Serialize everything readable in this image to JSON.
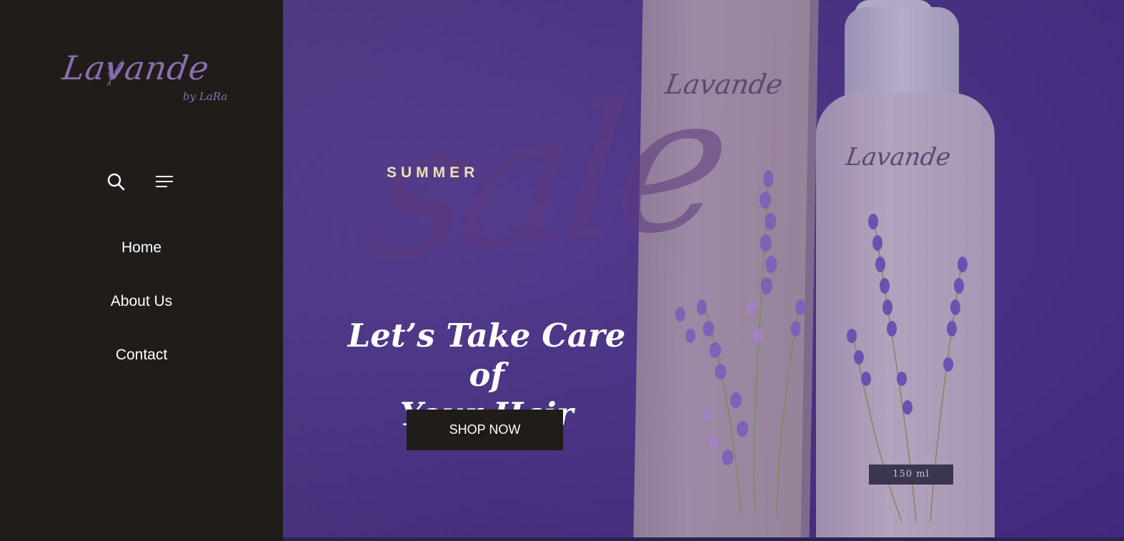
{
  "brand": {
    "logo_text": "Lavande",
    "logo_byline": "by LaRa"
  },
  "sidebar": {
    "icons": [
      "search-icon",
      "hamburger-menu-icon"
    ],
    "nav": [
      {
        "label": "Home"
      },
      {
        "label": "About Us"
      },
      {
        "label": "Contact"
      }
    ]
  },
  "hero": {
    "eyebrow": "SUMMER",
    "script_word": "sale",
    "headline_line1": "Let’s Take Care of",
    "headline_line2": "Your Hair",
    "cta_label": "SHOP NOW",
    "product_volume": "150 ml"
  },
  "colors": {
    "sidebar_bg": "#1f1c1a",
    "hero_bg": "#4a3288",
    "accent_gold": "#ece0b7",
    "logo_purple": "#8a6fae"
  }
}
